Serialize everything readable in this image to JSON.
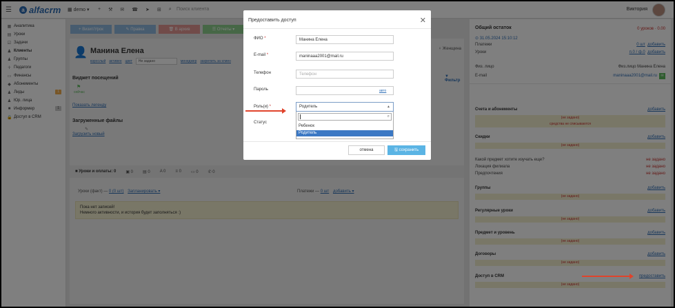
{
  "topbar": {
    "logo_text": "alfacrm",
    "branch": "demo",
    "search_placeholder": "Поиск клиента",
    "user_name": "Виктория"
  },
  "sidebar": {
    "items": [
      {
        "label": "Аналитика",
        "icon": "chart-icon"
      },
      {
        "label": "Уроки",
        "icon": "calendar-icon"
      },
      {
        "label": "Задачи",
        "icon": "tasks-icon"
      },
      {
        "label": "Клиенты",
        "icon": "user-icon"
      },
      {
        "label": "Группы",
        "icon": "group-icon"
      },
      {
        "label": "Педагоги",
        "icon": "teacher-icon"
      },
      {
        "label": "Финансы",
        "icon": "money-icon"
      },
      {
        "label": "Абонементы",
        "icon": "tag-icon"
      },
      {
        "label": "Лиды",
        "icon": "lead-icon",
        "badge": "1"
      },
      {
        "label": "Юр. лица",
        "icon": "company-icon"
      },
      {
        "label": "Информер",
        "icon": "bell-icon",
        "badge": "1"
      },
      {
        "label": "Доступ в CRM",
        "icon": "lock-icon"
      }
    ]
  },
  "actions": [
    {
      "label": "+ Визит/Урок",
      "color": "#6fa8dc"
    },
    {
      "label": "✎ Правка",
      "color": "#6fa8dc"
    },
    {
      "label": "🗑 В архив",
      "color": "#d9534f"
    },
    {
      "label": "☰ Отчеты ▾",
      "color": "#5cb85c"
    }
  ],
  "client": {
    "name": "Манина Елена",
    "status1": "взрослый",
    "status2": "активен",
    "status3": "цвет",
    "select": "Не задано",
    "manager": "менеджер",
    "assign": "закрепить за клиен",
    "gender": "♀ Женщина"
  },
  "visits": {
    "title": "Виджет посещений",
    "now": "сейчас",
    "legend": "Показать легенду",
    "filter": "▼ Фильтр"
  },
  "files": {
    "title": "Загруженные файлы",
    "upload": "Загрузить новый"
  },
  "tabs": [
    "■ Уроки и оплаты: 0",
    "▣ 0",
    "▤ 0",
    "A 0",
    "≡ 0",
    "▭ 0",
    "✆ 0"
  ],
  "lessons": {
    "head_left_label": "Уроки (факт) —",
    "head_left_value": "0 (0 шт)",
    "head_plan": "Запланировать ▾",
    "head_right_label": "Платежи —",
    "head_right_value": "0 шт",
    "head_add": "добавить ▾",
    "empty_title": "Пока нет записей!",
    "empty_text": "Немного активности, и история будет заполняться :)"
  },
  "right": {
    "balance_title": "Общий остаток",
    "balance_value": "0 уроков · 0.00",
    "date": "⊙ 31.05.2024 15:10:12",
    "payments": {
      "label": "Платежи",
      "value": "0 шт",
      "action": "добавить"
    },
    "lessons": {
      "label": "Уроки",
      "value": "п.0 / ф.0",
      "action": "добавить"
    },
    "contact_label": "Физ. лицо",
    "contact_value": "Физ.лицо Манина Елена",
    "email_label": "E-mail",
    "email_value": "maninaaa2001@mail.ru",
    "sections": [
      {
        "title": "Счета и абонементы",
        "action": "добавить",
        "box": "(не задано)",
        "box2": "средства не списываются"
      },
      {
        "title": "Скидки",
        "action": "добавить",
        "box": "(не задано)"
      },
      {
        "title": "Группы",
        "action": "добавить",
        "box": "(не задано)"
      },
      {
        "title": "Регулярные уроки",
        "action": "добавить",
        "box": "(не задано)"
      },
      {
        "title": "Предмет и уровень",
        "action": "добавить",
        "box": "(не задано)"
      },
      {
        "title": "Договоры",
        "action": "добавить",
        "box": "(не задано)"
      },
      {
        "title": "Доступ в CRM",
        "action": "предоставить",
        "box": "(не задано)"
      }
    ],
    "questions": [
      {
        "label": "Какой предмет хотите изучать еще?",
        "value": "не задано"
      },
      {
        "label": "Локация филиала",
        "value": "не задано"
      },
      {
        "label": "Предпочтения",
        "value": "не задано"
      }
    ]
  },
  "modal": {
    "title": "Предоставить доступ",
    "fio_label": "ФИО",
    "fio_value": "Манина Елена",
    "email_label": "E-mail",
    "email_value": "maninaaa2001@mail.ru",
    "phone_label": "Телефон",
    "phone_placeholder": "Телефон",
    "password_label": "Пароль",
    "password_link": "авто",
    "role_label": "Роль(и)",
    "role_value": "Родитель",
    "status_label": "Статус",
    "options": [
      "Ребенок",
      "Родитель"
    ],
    "cancel": "отмена",
    "save": "🖫 сохранить"
  },
  "colors": {
    "accent": "#2d6db5",
    "arrow": "#e0432b",
    "save": "#5bb4e4"
  }
}
